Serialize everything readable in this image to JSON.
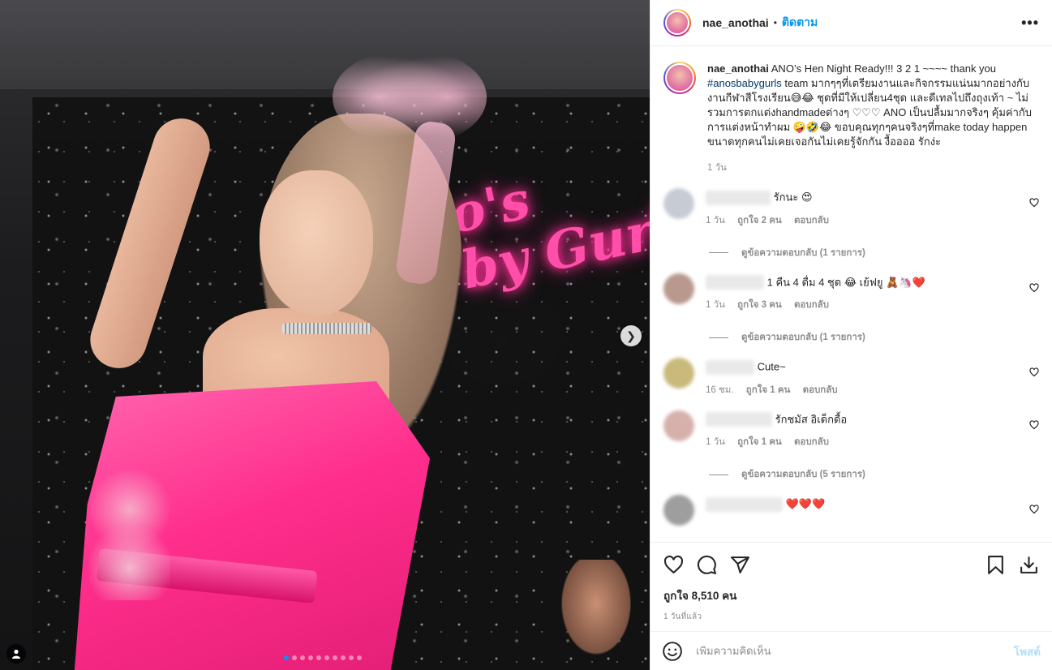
{
  "photo": {
    "neon_text": "o's\nby Gurls",
    "carousel": {
      "count": 10,
      "active_index": 0
    }
  },
  "header": {
    "username": "nae_anothai",
    "separator": "•",
    "follow_label": "ติดตาม",
    "more_label": "•••"
  },
  "caption": {
    "username": "nae_anothai",
    "text_part1": " ANO’s Hen Night Ready!!! 3 2 1 ~~~~ thank you ",
    "hashtag": "#anosbabygurls",
    "text_part2": " team มากๆๆที่เตรียมงานและกิจกรรมแน่นมากอย่างกับงานกีฬาสีโรงเรียน😅😂 ชุดที่มีให้เปลี่ยน4ชุด และดีเทลไปถึงถุงเท้า ~ ไม่รวมการตกแต่งhandmadeต่างๆ ♡♡♡ ANO เป็นปลื้มมากจริงๆ คุ้มค่ากับการแต่งหน้าทำผม 🤪🤣😂 ขอบคุณทุกๆคนจริงๆที่make today happen ขนาดทุกคนไม่เคยเจอกันไม่เคยรู้จักกัน งื้ออออ รักง่ะ",
    "time": "1 วัน"
  },
  "comments": [
    {
      "text": "รักนะ 😍",
      "time": "1 วัน",
      "likes": "ถูกใจ 2 คน",
      "reply": "ตอบกลับ",
      "view_replies": "ดูข้อความตอบกลับ (1 รายการ)",
      "avatar_color": "#c7ccd4"
    },
    {
      "text": "1 คืน 4 ตื่ม 4 ชุด 😂 เย้ฟยู 🧸🦄❤️",
      "time": "1 วัน",
      "likes": "ถูกใจ 3 คน",
      "reply": "ตอบกลับ",
      "view_replies": "ดูข้อความตอบกลับ (1 รายการ)",
      "avatar_color": "#b9998e"
    },
    {
      "text": "Cute~",
      "time": "16 ชม.",
      "likes": "ถูกใจ 1 คน",
      "reply": "ตอบกลับ",
      "view_replies": "",
      "avatar_color": "#c9b97a"
    },
    {
      "text": "รักชมัส อิเด็กดื้อ",
      "time": "1 วัน",
      "likes": "ถูกใจ 1 คน",
      "reply": "ตอบกลับ",
      "view_replies": "ดูข้อความตอบกลับ (5 รายการ)",
      "avatar_color": "#d6b1ac"
    },
    {
      "text": "❤️❤️❤️",
      "time": "",
      "likes": "",
      "reply": "",
      "view_replies": "",
      "avatar_color": "#9e9e9e"
    }
  ],
  "actions": {
    "likes_text": "ถูกใจ 8,510 คน",
    "posted_ago": "1 วันที่แล้ว"
  },
  "add_comment": {
    "placeholder": "เพิ่มความคิดเห็น",
    "post_label": "โพสต์"
  },
  "icons": [
    "heart-icon",
    "comment-icon",
    "share-icon",
    "bookmark-icon",
    "download-icon",
    "emoji-icon",
    "user-tag-icon",
    "chevron-right-icon",
    "more-icon"
  ]
}
